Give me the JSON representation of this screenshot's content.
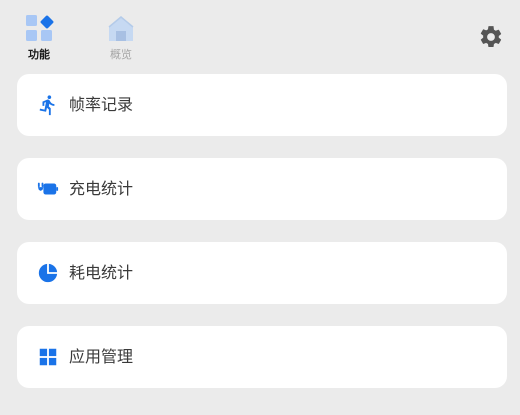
{
  "colors": {
    "accent": "#1a73e8",
    "accent_light": "#a8c7f5",
    "inactive": "#a6a6a6",
    "background": "#ebebeb",
    "card": "#ffffff"
  },
  "tabs": [
    {
      "label": "功能",
      "icon": "grid-diamond-icon",
      "selected": true
    },
    {
      "label": "概览",
      "icon": "home-icon",
      "selected": false
    }
  ],
  "header": {
    "settings_icon": "gear-icon"
  },
  "cards": [
    {
      "label": "帧率记录",
      "icon": "running-person-icon"
    },
    {
      "label": "充电统计",
      "icon": "charging-battery-icon"
    },
    {
      "label": "耗电统计",
      "icon": "pie-chart-icon"
    },
    {
      "label": "应用管理",
      "icon": "apps-grid-icon"
    }
  ]
}
